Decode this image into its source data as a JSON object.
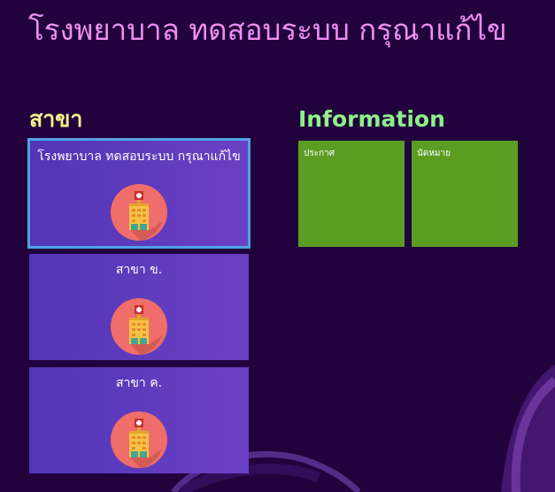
{
  "app": {
    "title": "โรงพยาบาล ทดสอบระบบ กรุณาแก้ไข"
  },
  "branches": {
    "heading": "สาขา",
    "items": [
      {
        "name": "โรงพยาบาล ทดสอบระบบ กรุณาแก้ไข",
        "icon": "hospital-icon",
        "selected": true
      },
      {
        "name": "สาขา ข.",
        "icon": "hospital-icon",
        "selected": false
      },
      {
        "name": "สาขา ค.",
        "icon": "hospital-icon",
        "selected": false
      }
    ]
  },
  "information": {
    "heading": "Information",
    "tiles": [
      {
        "label": "ประกาศ"
      },
      {
        "label": "นัดหมาย"
      }
    ]
  },
  "colors": {
    "background": "#21023c",
    "title": "#ef8ef0",
    "branches_heading": "#f6f08a",
    "information_heading": "#8ff08a",
    "branch_tile": "#5d3bbd",
    "selected_border": "#4fa3e6",
    "info_tile": "#5b9c23"
  }
}
